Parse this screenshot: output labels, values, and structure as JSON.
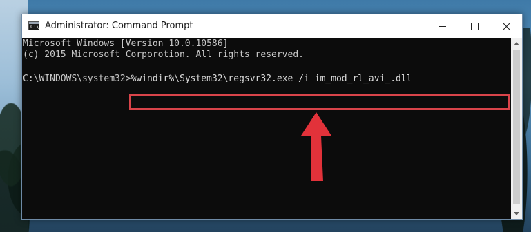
{
  "window": {
    "title": "Administrator: Command Prompt",
    "icon_text": "C:\\",
    "icon": "command-prompt-icon"
  },
  "controls": {
    "minimize_icon": "minimize-icon",
    "maximize_icon": "maximize-icon",
    "close_icon": "close-icon"
  },
  "console": {
    "line1": "Microsoft Windows [Version 10.0.10586]",
    "line2": "(c) 2015 Microsoft Corporotion. All rights reserved.",
    "prompt": "C:\\WINDOWS\\system32",
    "prompt_symbol": ">",
    "command": "%windir%\\System32\\regsvr32.exe /i im_mod_rl_avi_.dll"
  },
  "annotation": {
    "highlight_color": "#d9444a",
    "arrow_color": "#e2323a"
  },
  "colors": {
    "console_bg": "#0c0c0c",
    "console_text": "#c8c8c8",
    "titlebar_bg": "#ffffff"
  }
}
